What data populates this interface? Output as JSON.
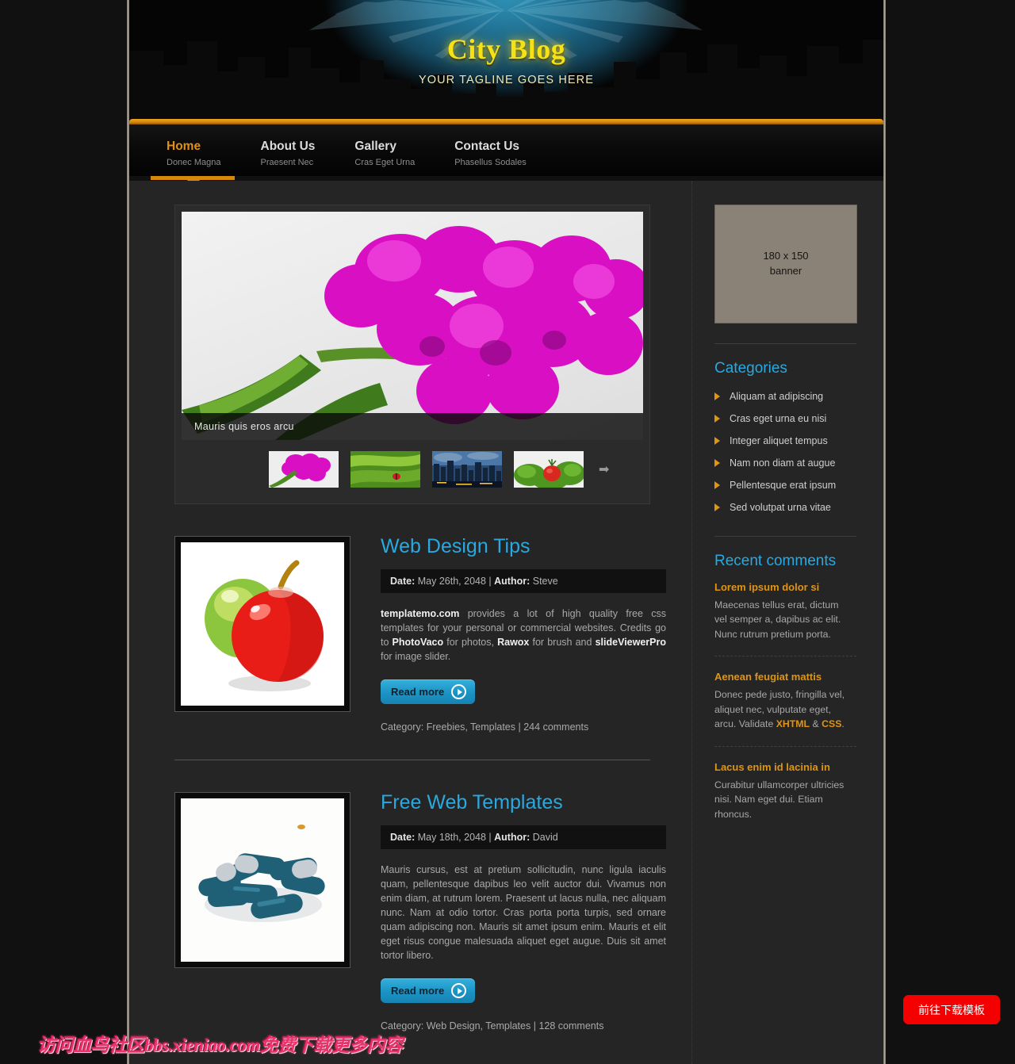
{
  "header": {
    "title": "City Blog",
    "tagline": "YOUR TAGLINE GOES HERE"
  },
  "nav": {
    "items": [
      {
        "title": "Home",
        "sub": "Donec Magna",
        "active": true
      },
      {
        "title": "About Us",
        "sub": "Praesent Nec",
        "active": false
      },
      {
        "title": "Gallery",
        "sub": "Cras Eget Urna",
        "active": false
      },
      {
        "title": "Contact Us",
        "sub": "Phasellus Sodales",
        "active": false
      }
    ]
  },
  "slider": {
    "caption": "Mauris quis eros arcu",
    "next_label": "➡",
    "thumbs": [
      "orchid-thumb",
      "ladybug-leaf-thumb",
      "city-skyline-thumb",
      "tomato-salad-thumb"
    ]
  },
  "articles": [
    {
      "title": "Web Design Tips",
      "date_label": "Date:",
      "date": "May 26th, 2048",
      "author_label": "Author:",
      "author": "Steve",
      "thumb": "two-apples-photo",
      "read_more": "Read more",
      "category_label": "Category:",
      "categories": "Freebies, Templates",
      "comments": "244 comments"
    },
    {
      "title": "Free Web Templates",
      "date_label": "Date:",
      "date": "May 18th, 2048",
      "author_label": "Author:",
      "author": "David",
      "thumb": "blue-capsules-photo",
      "body": "Mauris cursus, est at pretium sollicitudin, nunc ligula iaculis quam, pellentesque dapibus leo velit auctor dui. Vivamus non enim diam, at rutrum lorem. Praesent ut lacus nulla, nec aliquam nunc. Nam at odio tortor. Cras porta porta turpis, sed ornare quam adipiscing non. Mauris sit amet ipsum enim. Mauris et elit eget risus congue malesuada aliquet eget augue. Duis sit amet tortor libero.",
      "read_more": "Read more",
      "category_label": "Category:",
      "categories": "Web Design, Templates",
      "comments": "128 comments"
    }
  ],
  "article1_text": {
    "part1": "templatemo.com",
    "part2": " provides a lot of high quality free css templates for your personal or commercial websites. Credits go to ",
    "part3": "PhotoVaco",
    "part4": " for photos, ",
    "part5": "Rawox",
    "part6": " for brush and ",
    "part7": "slideViewerPro",
    "part8": " for image slider."
  },
  "sidebar": {
    "banner": {
      "line1": "180 x 150",
      "line2": "banner"
    },
    "categories_heading": "Categories",
    "categories": [
      "Aliquam at adipiscing",
      "Cras eget urna eu nisi",
      "Integer aliquet tempus",
      "Nam non diam at augue",
      "Pellentesque erat ipsum",
      "Sed volutpat urna vitae"
    ],
    "comments_heading": "Recent comments",
    "comments": [
      {
        "title": "Lorem ipsum dolor si",
        "text": "Maecenas tellus erat, dictum vel semper a, dapibus ac elit. Nunc rutrum pretium porta."
      },
      {
        "title": "Aenean feugiat mattis",
        "text_a": "Donec pede justo, fringilla vel, aliquet nec, vulputate eget, arcu. Validate ",
        "link1": "XHTML",
        "text_b": " & ",
        "link2": "CSS",
        "text_c": "."
      },
      {
        "title": "Lacus enim id lacinia in",
        "text": "Curabitur ullamcorper ultricies nisi. Nam eget dui. Etiam rhoncus."
      }
    ]
  },
  "overlays": {
    "watermark": "访问血鸟社区bbs.xieniao.com免费下载更多内容",
    "download_button": "前往下载模板"
  },
  "colors": {
    "accent_blue": "#29a9e0",
    "accent_orange": "#e09412",
    "title_yellow": "#f5e216",
    "nav_bar": "#d4890d",
    "watermark_pink": "#e8336b",
    "download_red": "#f50000"
  }
}
